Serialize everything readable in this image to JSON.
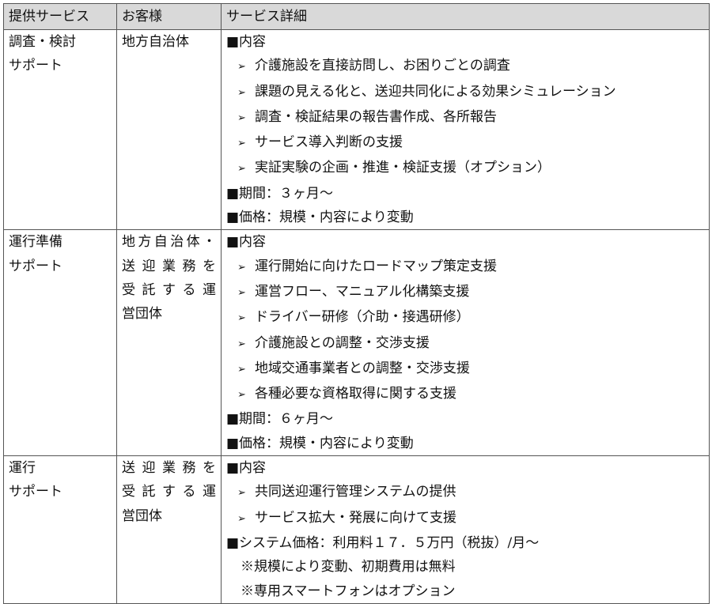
{
  "header": {
    "service": "提供サービス",
    "customer": "お客様",
    "detail": "サービス詳細"
  },
  "rows": [
    {
      "service": [
        "調査・検討",
        "サポート"
      ],
      "customer": [
        "地方自治体"
      ],
      "details": [
        {
          "kind": "head",
          "text": "■内容"
        },
        {
          "kind": "bullet",
          "text": "介護施設を直接訪問し、お困りごとの調査"
        },
        {
          "kind": "bullet",
          "text": "課題の見える化と、送迎共同化による効果シミュレーション"
        },
        {
          "kind": "bullet",
          "text": "調査・検証結果の報告書作成、各所報告"
        },
        {
          "kind": "bullet",
          "text": "サービス導入判断の支援"
        },
        {
          "kind": "bullet",
          "text": "実証実験の企画・推進・検証支援（オプション）"
        },
        {
          "kind": "head",
          "text": "■期間：３ヶ月～"
        },
        {
          "kind": "head",
          "text": "■価格：規模・内容により変動"
        }
      ]
    },
    {
      "service": [
        "運行準備",
        "サポート"
      ],
      "customer": [
        "地方自治体・",
        "送迎業務を",
        "受託する運",
        "営団体"
      ],
      "details": [
        {
          "kind": "head",
          "text": "■内容"
        },
        {
          "kind": "bullet",
          "text": "運行開始に向けたロードマップ策定支援"
        },
        {
          "kind": "bullet",
          "text": "運営フロー、マニュアル化構築支援"
        },
        {
          "kind": "bullet",
          "text": "ドライバー研修（介助・接遇研修）"
        },
        {
          "kind": "bullet",
          "text": "介護施設との調整・交渉支援"
        },
        {
          "kind": "bullet",
          "text": "地域交通事業者との調整・交渉支援"
        },
        {
          "kind": "bullet",
          "text": "各種必要な資格取得に関する支援"
        },
        {
          "kind": "head",
          "text": "■期間：６ヶ月～"
        },
        {
          "kind": "head",
          "text": "■価格：規模・内容により変動"
        }
      ]
    },
    {
      "service": [
        "運行",
        "サポート"
      ],
      "customer": [
        "送迎業務を",
        "受託する運",
        "営団体"
      ],
      "details": [
        {
          "kind": "head",
          "text": "■内容"
        },
        {
          "kind": "bullet",
          "text": "共同送迎運行管理システムの提供"
        },
        {
          "kind": "bullet",
          "text": "サービス拡大・発展に向けて支援"
        },
        {
          "kind": "head",
          "text": "■システム価格：利用料１７．５万円（税抜）/月～"
        },
        {
          "kind": "note",
          "text": "※規模により変動、初期費用は無料"
        },
        {
          "kind": "note",
          "text": "※専用スマートフォンはオプション"
        }
      ]
    }
  ],
  "bullet_glyph": "➢"
}
